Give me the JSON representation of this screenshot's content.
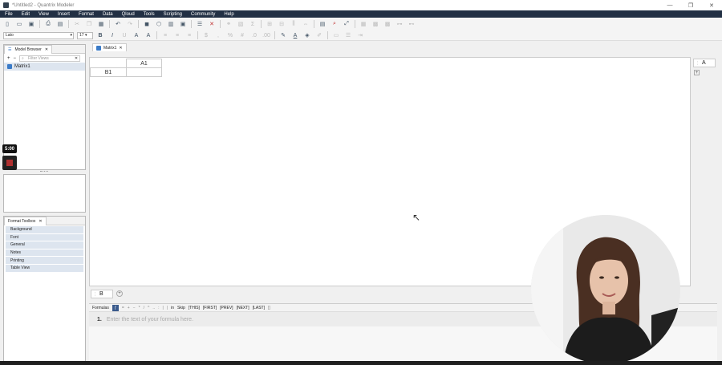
{
  "window": {
    "title": "*Untitled2 - Quantrix Modeler",
    "minimize": "—",
    "maximize": "❐",
    "close": "✕"
  },
  "menu": [
    "File",
    "Edit",
    "View",
    "Insert",
    "Format",
    "Data",
    "Qloud",
    "Tools",
    "Scripting",
    "Community",
    "Help"
  ],
  "format_bar": {
    "font": "Lato",
    "size": "17"
  },
  "model_browser": {
    "tab_label": "Model Browser",
    "filter_placeholder": "Filter Views",
    "items": [
      "Matrix1"
    ]
  },
  "format_toolbox": {
    "tab_label": "Format Toolbox",
    "items": [
      "Background",
      "Font",
      "General",
      "Notes",
      "Printing",
      "Table View"
    ]
  },
  "view": {
    "tab_label": "Matrix1",
    "column_header": "A1",
    "row_header": "B1",
    "right_category": "A",
    "bottom_category": "B"
  },
  "formulas": {
    "label": "Formulas",
    "keywords": [
      "in",
      "Skip",
      "[THIS]",
      "[FIRST]",
      "[PREV]",
      "[NEXT]",
      "[LAST]"
    ],
    "line_number": "1.",
    "placeholder": "Enter the text of your formula here."
  },
  "recording": {
    "timer": "5:00"
  }
}
